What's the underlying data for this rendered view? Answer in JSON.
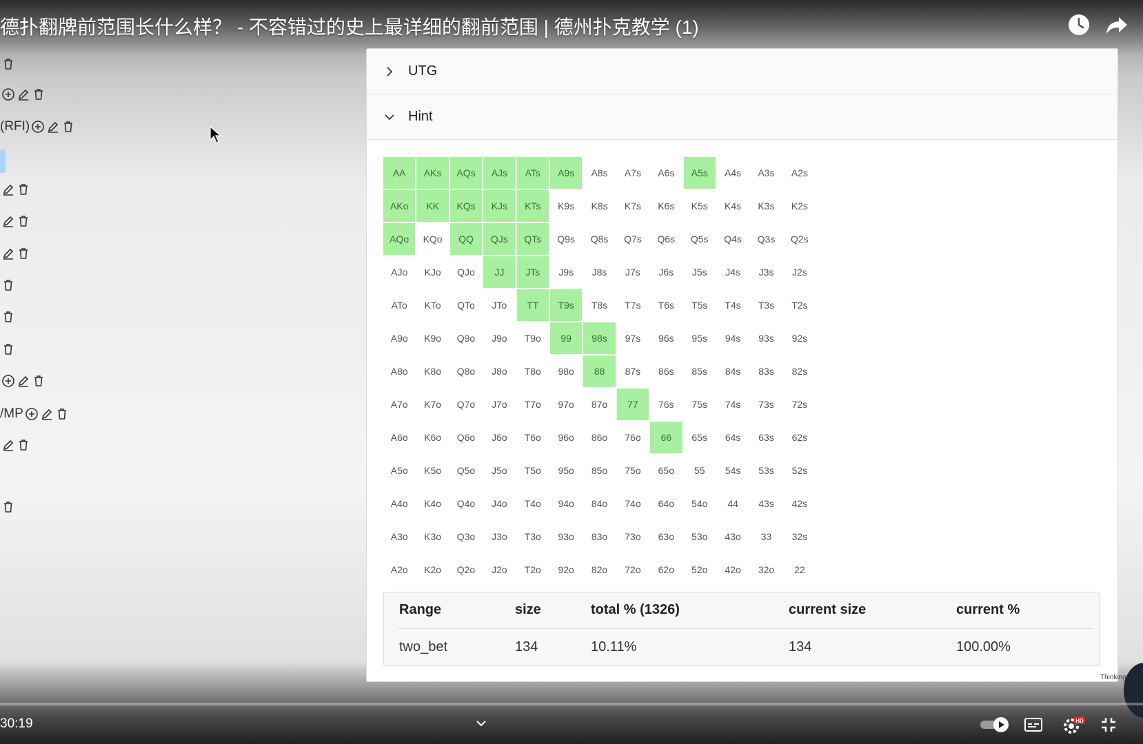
{
  "video": {
    "title": "德扑翻牌前范围长什么样？ - 不容错过的史上最详细的翻前范围 | 德州扑克教学 (1)",
    "time": "30:19",
    "watermark": "Thinking"
  },
  "left_list": {
    "rows": [
      {
        "label": "",
        "icons": [
          "trash-icon"
        ]
      },
      {
        "label": "",
        "icons": [
          "add-circle-icon",
          "edit-icon",
          "trash-icon"
        ]
      },
      {
        "label": "(RFI)",
        "icons": [
          "add-circle-icon",
          "edit-icon",
          "trash-icon"
        ]
      },
      {
        "label": "",
        "icons": [
          "edit-icon",
          "trash-icon"
        ]
      },
      {
        "label": "",
        "icons": [
          "edit-icon",
          "trash-icon"
        ]
      },
      {
        "label": "",
        "icons": [
          "edit-icon",
          "trash-icon"
        ]
      },
      {
        "label": "",
        "icons": [
          "trash-icon"
        ]
      },
      {
        "label": "",
        "icons": [
          "trash-icon"
        ]
      },
      {
        "label": "",
        "icons": [
          "trash-icon"
        ]
      },
      {
        "label": "",
        "icons": [
          "add-circle-icon",
          "edit-icon",
          "trash-icon"
        ]
      },
      {
        "label": "/MP",
        "icons": [
          "add-circle-icon",
          "edit-icon",
          "trash-icon"
        ]
      },
      {
        "label": "",
        "icons": [
          "edit-icon",
          "trash-icon"
        ]
      },
      {
        "label": "",
        "icons": [
          "trash-icon"
        ]
      }
    ]
  },
  "panel": {
    "sections": [
      {
        "label": "UTG",
        "expanded": false
      },
      {
        "label": "Hint",
        "expanded": true
      }
    ],
    "highlight_color": "#a8f0a0",
    "hands": [
      [
        "AA",
        "AKs",
        "AQs",
        "AJs",
        "ATs",
        "A9s",
        "A8s",
        "A7s",
        "A6s",
        "A5s",
        "A4s",
        "A3s",
        "A2s"
      ],
      [
        "AKo",
        "KK",
        "KQs",
        "KJs",
        "KTs",
        "K9s",
        "K8s",
        "K7s",
        "K6s",
        "K5s",
        "K4s",
        "K3s",
        "K2s"
      ],
      [
        "AQo",
        "KQo",
        "QQ",
        "QJs",
        "QTs",
        "Q9s",
        "Q8s",
        "Q7s",
        "Q6s",
        "Q5s",
        "Q4s",
        "Q3s",
        "Q2s"
      ],
      [
        "AJo",
        "KJo",
        "QJo",
        "JJ",
        "JTs",
        "J9s",
        "J8s",
        "J7s",
        "J6s",
        "J5s",
        "J4s",
        "J3s",
        "J2s"
      ],
      [
        "ATo",
        "KTo",
        "QTo",
        "JTo",
        "TT",
        "T9s",
        "T8s",
        "T7s",
        "T6s",
        "T5s",
        "T4s",
        "T3s",
        "T2s"
      ],
      [
        "A9o",
        "K9o",
        "Q9o",
        "J9o",
        "T9o",
        "99",
        "98s",
        "97s",
        "96s",
        "95s",
        "94s",
        "93s",
        "92s"
      ],
      [
        "A8o",
        "K8o",
        "Q8o",
        "J8o",
        "T8o",
        "98o",
        "88",
        "87s",
        "86s",
        "85s",
        "84s",
        "83s",
        "82s"
      ],
      [
        "A7o",
        "K7o",
        "Q7o",
        "J7o",
        "T7o",
        "97o",
        "87o",
        "77",
        "76s",
        "75s",
        "74s",
        "73s",
        "72s"
      ],
      [
        "A6o",
        "K6o",
        "Q6o",
        "J6o",
        "T6o",
        "96o",
        "86o",
        "76o",
        "66",
        "65s",
        "64s",
        "63s",
        "62s"
      ],
      [
        "A5o",
        "K5o",
        "Q5o",
        "J5o",
        "T5o",
        "95o",
        "85o",
        "75o",
        "65o",
        "55",
        "54s",
        "53s",
        "52s"
      ],
      [
        "A4o",
        "K4o",
        "Q4o",
        "J4o",
        "T4o",
        "94o",
        "84o",
        "74o",
        "64o",
        "54o",
        "44",
        "43s",
        "42s"
      ],
      [
        "A3o",
        "K3o",
        "Q3o",
        "J3o",
        "T3o",
        "93o",
        "83o",
        "73o",
        "63o",
        "53o",
        "43o",
        "33",
        "32s"
      ],
      [
        "A2o",
        "K2o",
        "Q2o",
        "J2o",
        "T2o",
        "92o",
        "82o",
        "72o",
        "62o",
        "52o",
        "42o",
        "32o",
        "22"
      ]
    ],
    "selected_hands": [
      "AA",
      "AKs",
      "AQs",
      "AJs",
      "ATs",
      "A9s",
      "A5s",
      "AKo",
      "KK",
      "KQs",
      "KJs",
      "KTs",
      "AQo",
      "QQ",
      "QJs",
      "QTs",
      "JJ",
      "JTs",
      "TT",
      "T9s",
      "99",
      "98s",
      "88",
      "77",
      "66"
    ]
  },
  "stats": {
    "headers": [
      "Range",
      "size",
      "total % (1326)",
      "current size",
      "current %"
    ],
    "row": [
      "two_bet",
      "134",
      "10.11%",
      "134",
      "100.00%"
    ]
  }
}
